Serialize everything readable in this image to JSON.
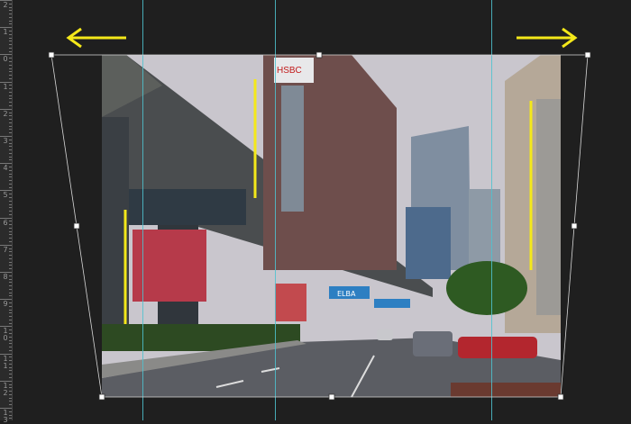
{
  "ruler": {
    "labels": [
      "2",
      "1",
      "0",
      "1",
      "2",
      "3",
      "4",
      "5",
      "6",
      "7",
      "8",
      "9",
      "10",
      "11",
      "12",
      "13"
    ]
  },
  "photo": {
    "signs": {
      "hsbc": "HSBC",
      "elba": "ELBA"
    }
  },
  "colors": {
    "guide": "#4fc3d0",
    "annotation": "#f4e81a",
    "canvas": "#1f1f1f",
    "handle": "#ffffff"
  },
  "tools": {
    "transform": "perspective-warp"
  }
}
